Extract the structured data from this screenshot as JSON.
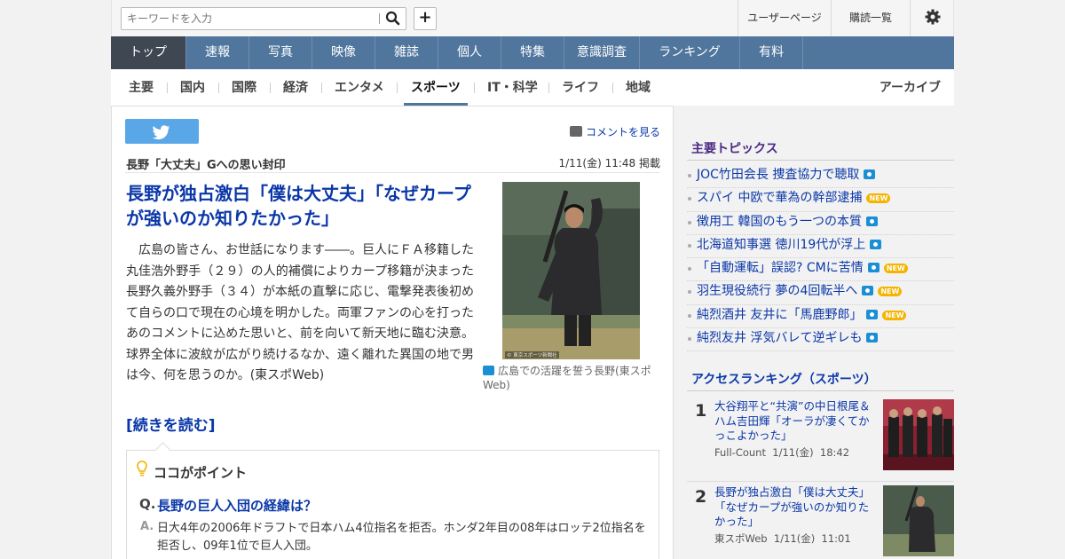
{
  "header": {
    "search_placeholder": "キーワードを入力",
    "plus_label": "+",
    "user_page": "ユーザーページ",
    "subscriptions": "購読一覧"
  },
  "main_nav": [
    "トップ",
    "速報",
    "写真",
    "映像",
    "雑誌",
    "個人",
    "特集",
    "意識調査",
    "ランキング",
    "有料"
  ],
  "sub_nav": [
    "主要",
    "国内",
    "国際",
    "経済",
    "エンタメ",
    "スポーツ",
    "IT・科学",
    "ライフ",
    "地域"
  ],
  "sub_nav_active": "スポーツ",
  "archive": "アーカイブ",
  "article": {
    "comment_link": "コメントを見る",
    "subhead": "長野「大丈夫」Gへの思い封印",
    "date": "1/11(金) 11:48 掲載",
    "headline": "長野が独占激白「僕は大丈夫」「なぜカープが強いのか知りたかった」",
    "body": "広島の皆さん、お世話になります――。巨人にＦＡ移籍した丸佳浩外野手（２９）の人的補償によりカープ移籍が決まった長野久義外野手（３４）が本紙の直撃に応じ、電撃発表後初めて自らの口で現在の心境を明かした。両軍ファンの心を打ったあのコメントに込めた思いと、前を向いて新天地に臨む決意。球界全体に波紋が広がり続けるなか、遠く離れた異国の地で男は今、何を思うのか。(東スポWeb)",
    "read_more": "[続きを読む]",
    "photo_caption": "広島での活躍を誓う長野(東スポWeb)",
    "photo_credit": "© 東京スポーツ新聞社"
  },
  "point": {
    "title": "ココがポイント",
    "q_mark": "Q.",
    "question": "長野の巨人入団の経緯は？",
    "a_mark": "A.",
    "answer": "日大4年の2006年ドラフトで日本ハム4位指名を拒否。ホンダ2年目の08年はロッテ2位指名を拒否し、09年1位で巨人入団。"
  },
  "sidebar": {
    "topics_title": "主要トピックス",
    "topics": [
      {
        "text": "JOC竹田会長 捜査協力で聴取",
        "camera": true,
        "new": false
      },
      {
        "text": "スパイ 中欧で華為の幹部逮捕",
        "camera": false,
        "new": true
      },
      {
        "text": "徴用工 韓国のもう一つの本質",
        "camera": true,
        "new": false
      },
      {
        "text": "北海道知事選 徳川19代が浮上",
        "camera": true,
        "new": false
      },
      {
        "text": "「自動運転」誤認? CMに苦情",
        "camera": true,
        "new": true
      },
      {
        "text": "羽生現役続行 夢の4回転半へ",
        "camera": true,
        "new": true
      },
      {
        "text": "純烈酒井 友井に「馬鹿野郎」",
        "camera": true,
        "new": true
      },
      {
        "text": "純烈友井 浮気バレて逆ギレも",
        "camera": true,
        "new": false
      }
    ],
    "new_badge": "NEW",
    "ranking_title": "アクセスランキング（スポーツ）",
    "ranking": [
      {
        "rank": "1",
        "title": "大谷翔平と“共演”の中日根尾＆ハム吉田輝「オーラが凄くてかっこよかった」",
        "source": "Full-Count",
        "date": "1/11(金)",
        "time": "18:42"
      },
      {
        "rank": "2",
        "title": "長野が独占激白「僕は大丈夫」「なぜカープが強いのか知りたかった」",
        "source": "東スポWeb",
        "date": "1/11(金)",
        "time": "11:01"
      }
    ]
  },
  "colors": {
    "nav_bg": "#50769d",
    "nav_active": "#3e4752",
    "link": "#0a37a8",
    "section_title": "#4b2882",
    "twitter": "#5aa7e8",
    "camera_icon": "#1b8fd3",
    "new_badge": "#f4b400"
  }
}
